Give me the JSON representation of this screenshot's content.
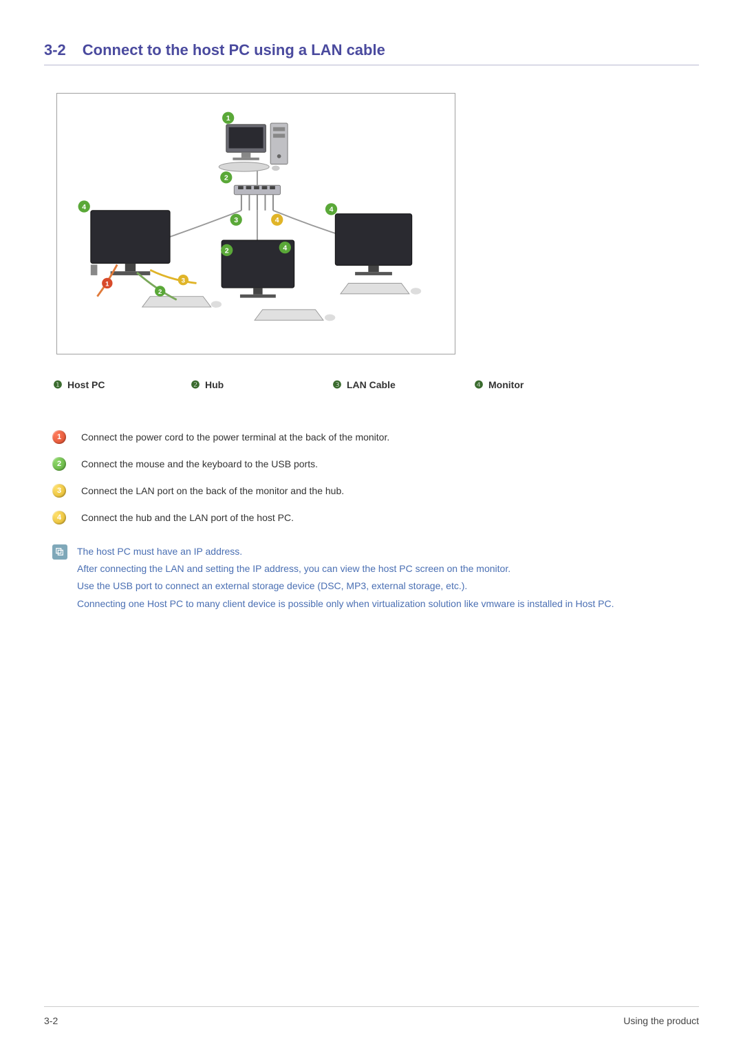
{
  "section": {
    "number": "3-2",
    "title": "Connect to the host PC using a LAN cable"
  },
  "legend": {
    "items": [
      {
        "num": "❶",
        "label": "Host PC"
      },
      {
        "num": "❷",
        "label": "Hub"
      },
      {
        "num": "❸",
        "label": "LAN Cable"
      },
      {
        "num": "❹",
        "label": "Monitor"
      }
    ]
  },
  "steps": [
    {
      "color": "c-red",
      "num": "1",
      "text": "Connect the power cord to the power terminal at the back of the monitor."
    },
    {
      "color": "c-green",
      "num": "2",
      "text": "Connect the mouse and the keyboard to the USB ports."
    },
    {
      "color": "c-yellow",
      "num": "3",
      "text": "Connect the LAN port on the back of the monitor and the hub."
    },
    {
      "color": "c-yellow",
      "num": "4",
      "text": "Connect the hub and the LAN port of the host PC."
    }
  ],
  "notes": [
    "The host PC must have an IP address.",
    "After connecting the LAN and setting the IP address, you can view the host PC screen on the monitor.",
    "Use the USB port to connect an external storage device (DSC, MP3, external storage, etc.).",
    "Connecting one Host PC to many client device is possible only when virtualization solution like vmware is installed in Host PC."
  ],
  "footer": {
    "left": "3-2",
    "right": "Using the product"
  }
}
